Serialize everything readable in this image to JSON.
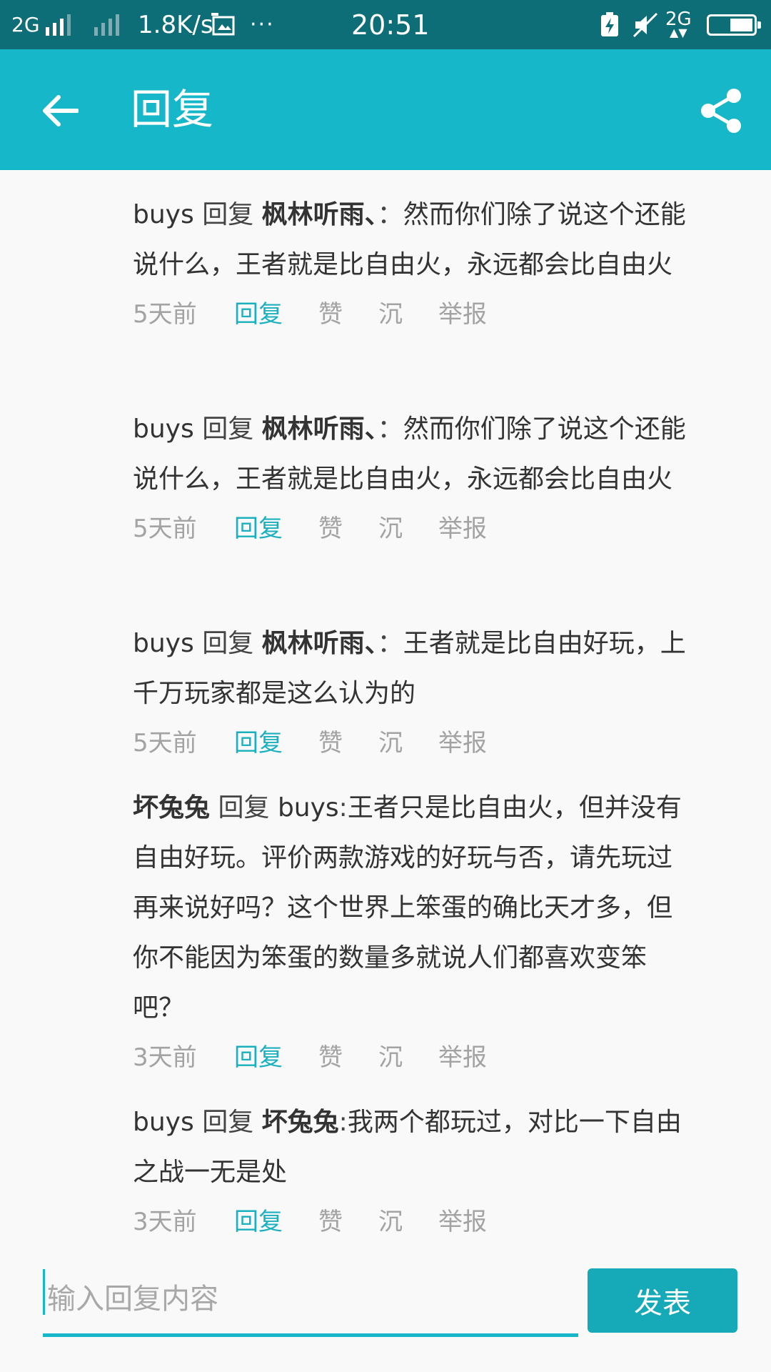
{
  "status_bar": {
    "network": "2G",
    "speed": "1.8K/s",
    "more": "···",
    "time": "20:51",
    "sim2": "2G",
    "sim2_index": "1"
  },
  "app_bar": {
    "title": "回复",
    "back_icon": "arrow-left-icon",
    "share_icon": "share-icon",
    "color": "#16b7c8"
  },
  "replies": [
    {
      "author": "buys",
      "verb": "回复",
      "target": "枫林听雨、",
      "separator": "：",
      "content": "然而你们除了说这个还能说什么，王者就是比自由火，永远都会比自由火",
      "time": "5天前",
      "reply_label": "回复",
      "like_label": "赞",
      "sink_label": "沉",
      "report_label": "举报"
    },
    {
      "author": "buys",
      "verb": "回复",
      "target": "枫林听雨、",
      "separator": "：",
      "content": "然而你们除了说这个还能说什么，王者就是比自由火，永远都会比自由火",
      "time": "5天前",
      "reply_label": "回复",
      "like_label": "赞",
      "sink_label": "沉",
      "report_label": "举报"
    },
    {
      "author": "buys",
      "verb": "回复",
      "target": "枫林听雨、",
      "separator": "：",
      "content": "王者就是比自由好玩，上千万玩家都是这么认为的",
      "time": "5天前",
      "reply_label": "回复",
      "like_label": "赞",
      "sink_label": "沉",
      "report_label": "举报"
    },
    {
      "author": "坏兔兔",
      "verb": "回复",
      "target": "buys",
      "separator": ":",
      "content": "王者只是比自由火，但并没有自由好玩。评价两款游戏的好玩与否，请先玩过再来说好吗？这个世界上笨蛋的确比天才多，但你不能因为笨蛋的数量多就说人们都喜欢变笨吧？",
      "time": "3天前",
      "reply_label": "回复",
      "like_label": "赞",
      "sink_label": "沉",
      "report_label": "举报"
    },
    {
      "author": "buys",
      "verb": "回复",
      "target": "坏兔兔",
      "separator": ":",
      "content": "我两个都玩过，对比一下自由之战一无是处",
      "time": "3天前",
      "reply_label": "回复",
      "like_label": "赞",
      "sink_label": "沉",
      "report_label": "举报"
    }
  ],
  "input_bar": {
    "placeholder": "输入回复内容",
    "value": "",
    "submit_label": "发表"
  },
  "colors": {
    "accent": "#16b7c8",
    "status_bar": "#0e6e78",
    "link": "#1ab0c0",
    "meta": "#a3a3a3"
  }
}
